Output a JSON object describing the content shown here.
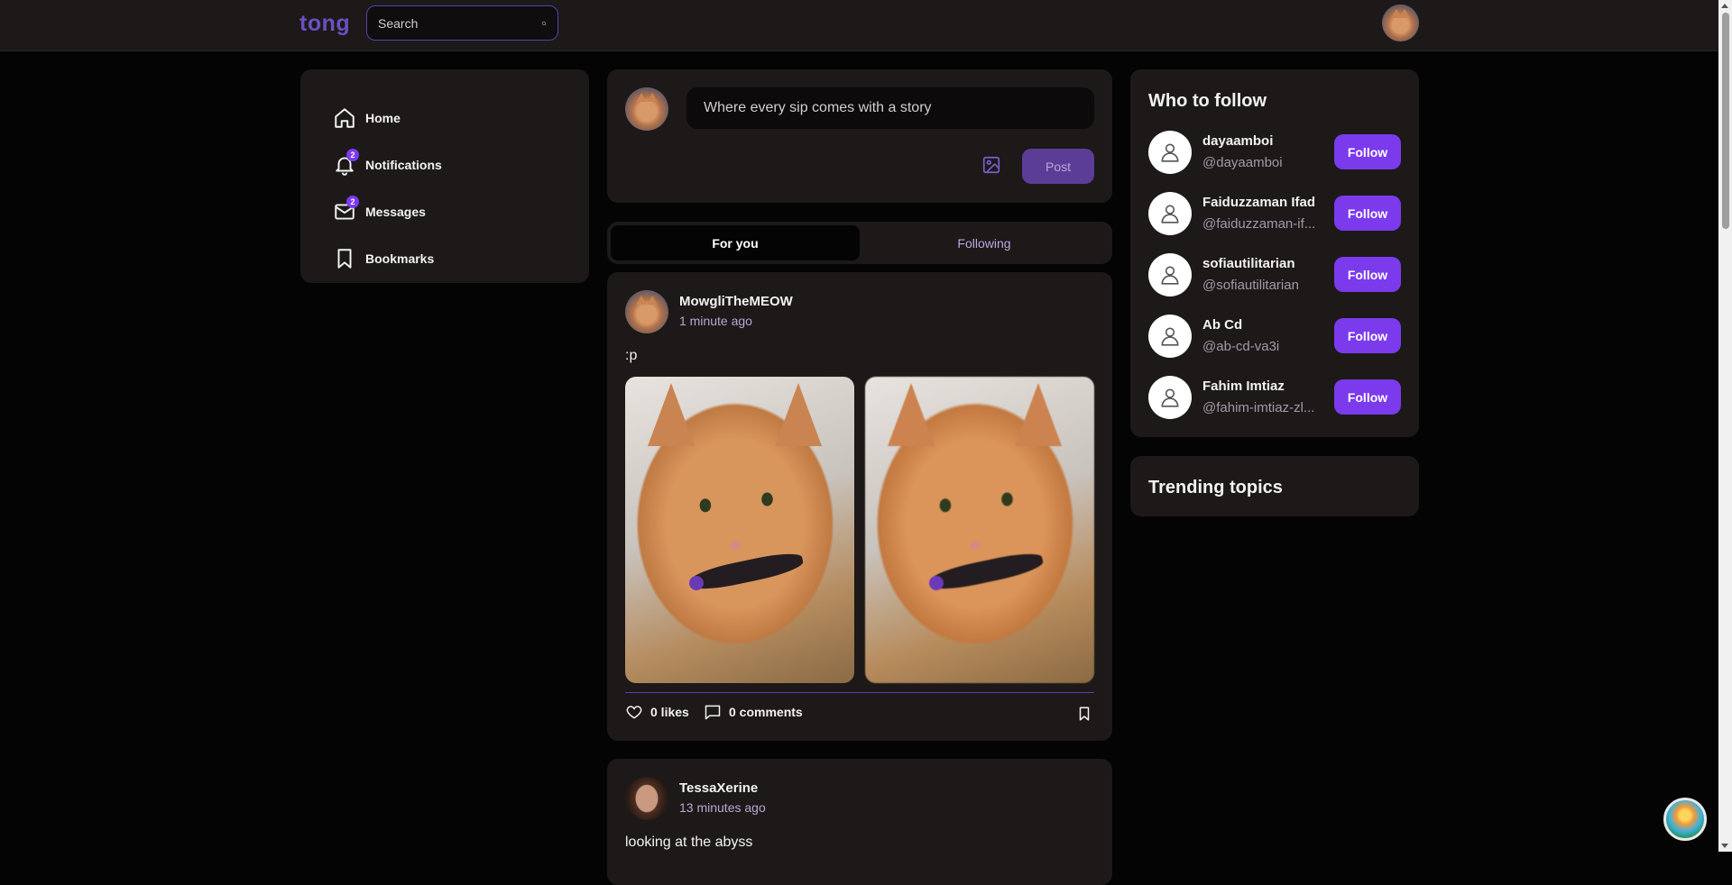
{
  "header": {
    "logo": "tong",
    "search_placeholder": "Search"
  },
  "nav": {
    "items": [
      {
        "label": "Home",
        "icon": "home-icon"
      },
      {
        "label": "Notifications",
        "icon": "bell-icon",
        "badge": "2"
      },
      {
        "label": "Messages",
        "icon": "mail-icon",
        "badge": "2"
      },
      {
        "label": "Bookmarks",
        "icon": "bookmark-icon"
      }
    ]
  },
  "composer": {
    "placeholder": "Where every sip comes with a story",
    "post_label": "Post"
  },
  "tabs": {
    "for_you": "For you",
    "following": "Following"
  },
  "posts": [
    {
      "author": "MowgliTheMEOW",
      "time": "1 minute ago",
      "text": ":p",
      "likes": "0 likes",
      "comments": "0 comments"
    },
    {
      "author": "TessaXerine",
      "time": "13 minutes ago",
      "text": "looking at the abyss"
    }
  ],
  "who_to_follow": {
    "title": "Who to follow",
    "follow_label": "Follow",
    "users": [
      {
        "name": "dayaamboi",
        "handle": "@dayaamboi"
      },
      {
        "name": "Faiduzzaman Ifad",
        "handle": "@faiduzzaman-if..."
      },
      {
        "name": "sofiautilitarian",
        "handle": "@sofiautilitarian"
      },
      {
        "name": "Ab Cd",
        "handle": "@ab-cd-va3i"
      },
      {
        "name": "Fahim Imtiaz",
        "handle": "@fahim-imtiaz-zl..."
      }
    ]
  },
  "trending": {
    "title": "Trending topics"
  },
  "colors": {
    "accent": "#7c3aed",
    "background": "#050404",
    "card": "#1c1918"
  }
}
